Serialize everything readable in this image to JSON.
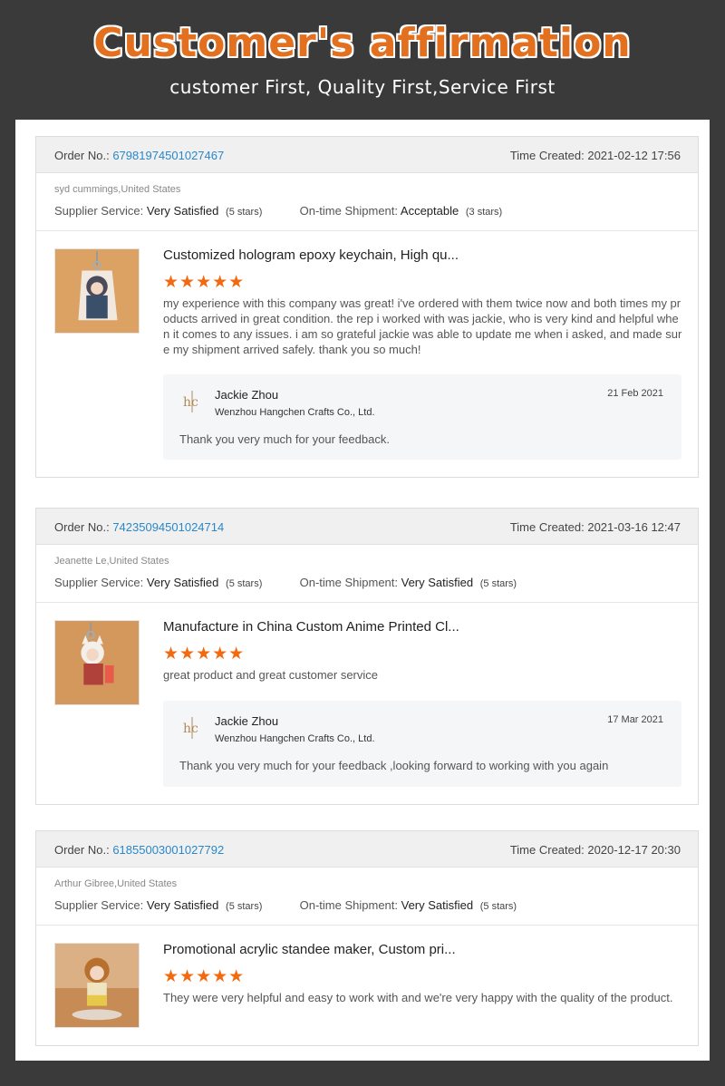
{
  "header": {
    "title": "Customer's affirmation",
    "subtitle": "customer First, Quality First,Service First"
  },
  "labels": {
    "order_no": "Order No.:",
    "time_created": "Time Created:",
    "supplier_service": "Supplier Service:",
    "ontime_shipment": "On-time Shipment:"
  },
  "reviews": [
    {
      "order_no": "67981974501027467",
      "time_created": "2021-02-12 17:56",
      "buyer": "syd cummings,United States",
      "supplier_service": "Very Satisfied",
      "supplier_stars": "(5 stars)",
      "shipment": "Acceptable",
      "shipment_stars": "(3 stars)",
      "product_title": "Customized hologram epoxy keychain, High qu...",
      "rating": 5,
      "stars": "★★★★★",
      "comment": "my experience with this company was great! i've ordered with them twice now and both times my products arrived in great condition. the rep i worked with was jackie, who is very kind and helpful when it comes to any issues. i am so grateful jackie was able to update me when i asked, and made sure my shipment arrived safely. thank you so much!",
      "reply": {
        "name": "Jackie Zhou",
        "company": "Wenzhou Hangchen Crafts Co., Ltd.",
        "date": "21 Feb 2021",
        "message": "Thank you very much for your feedback."
      }
    },
    {
      "order_no": "74235094501024714",
      "time_created": "2021-03-16 12:47",
      "buyer": "Jeanette Le,United States",
      "supplier_service": "Very Satisfied",
      "supplier_stars": "(5 stars)",
      "shipment": "Very Satisfied",
      "shipment_stars": "(5 stars)",
      "product_title": "Manufacture in China Custom Anime Printed Cl...",
      "rating": 5,
      "stars": "★★★★★",
      "comment": "great product and great customer service",
      "reply": {
        "name": "Jackie Zhou",
        "company": "Wenzhou Hangchen Crafts Co., Ltd.",
        "date": "17 Mar 2021",
        "message": "Thank you very much for your feedback ,looking forward to working with you again"
      }
    },
    {
      "order_no": "61855003001027792",
      "time_created": "2020-12-17 20:30",
      "buyer": "Arthur Gibree,United States",
      "supplier_service": "Very Satisfied",
      "supplier_stars": "(5 stars)",
      "shipment": "Very Satisfied",
      "shipment_stars": "(5 stars)",
      "product_title": "Promotional acrylic standee maker, Custom pri...",
      "rating": 5,
      "stars": "★★★★★",
      "comment": "They were very helpful and easy to work with and we're very happy with the quality of the product."
    }
  ],
  "colors": {
    "background": "#3a3a3a",
    "title_orange": "#e3701f",
    "star_orange": "#f26a10",
    "order_link": "#2a87c8"
  }
}
